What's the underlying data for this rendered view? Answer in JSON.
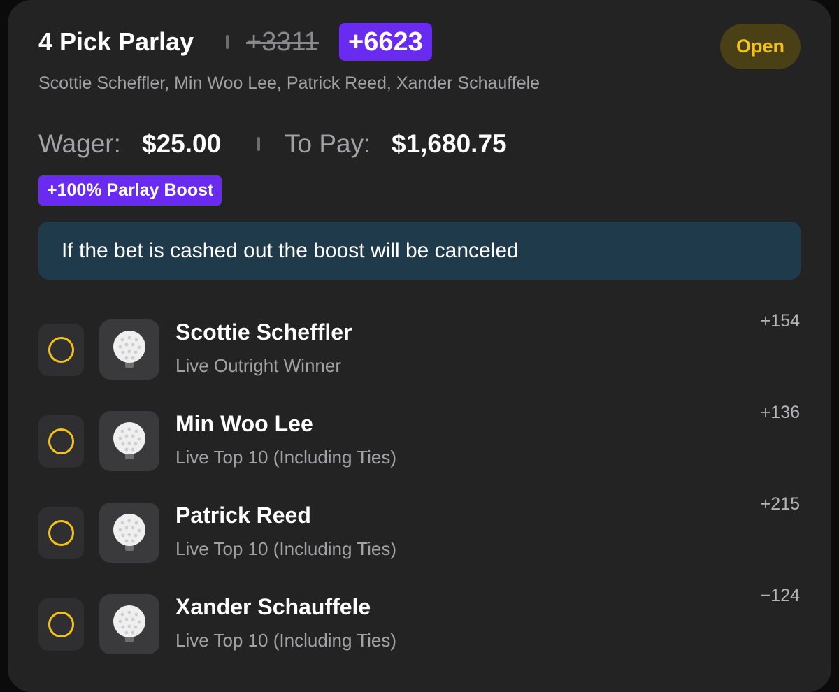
{
  "bet": {
    "title": "4 Pick Parlay",
    "original_odds": "+3311",
    "boosted_odds": "+6623",
    "status": "Open",
    "legs_summary": "Scottie Scheffler, Min Woo Lee, Patrick Reed, Xander Schauffele"
  },
  "wager": {
    "wager_label": "Wager:",
    "wager_value": "$25.00",
    "topay_label": "To Pay:",
    "topay_value": "$1,680.75"
  },
  "boost": {
    "label": "+100% Parlay Boost",
    "notice": "If the bet is cashed out the boost will be canceled"
  },
  "legs": [
    {
      "player": "Scottie Scheffler",
      "market": "Live Outright Winner",
      "odds": "+154",
      "icon": "golf-ball-icon"
    },
    {
      "player": "Min Woo Lee",
      "market": "Live Top 10 (Including Ties)",
      "odds": "+136",
      "icon": "golf-ball-icon"
    },
    {
      "player": "Patrick Reed",
      "market": "Live Top 10 (Including Ties)",
      "odds": "+215",
      "icon": "golf-ball-icon"
    },
    {
      "player": "Xander Schauffele",
      "market": "Live Top 10 (Including Ties)",
      "odds": "−124",
      "icon": "golf-ball-icon"
    }
  ],
  "colors": {
    "card_background": "#232324",
    "boost_purple": "#6a2bf0",
    "status_yellow": "#f3c21a",
    "notice_background": "#1f3a4b"
  }
}
